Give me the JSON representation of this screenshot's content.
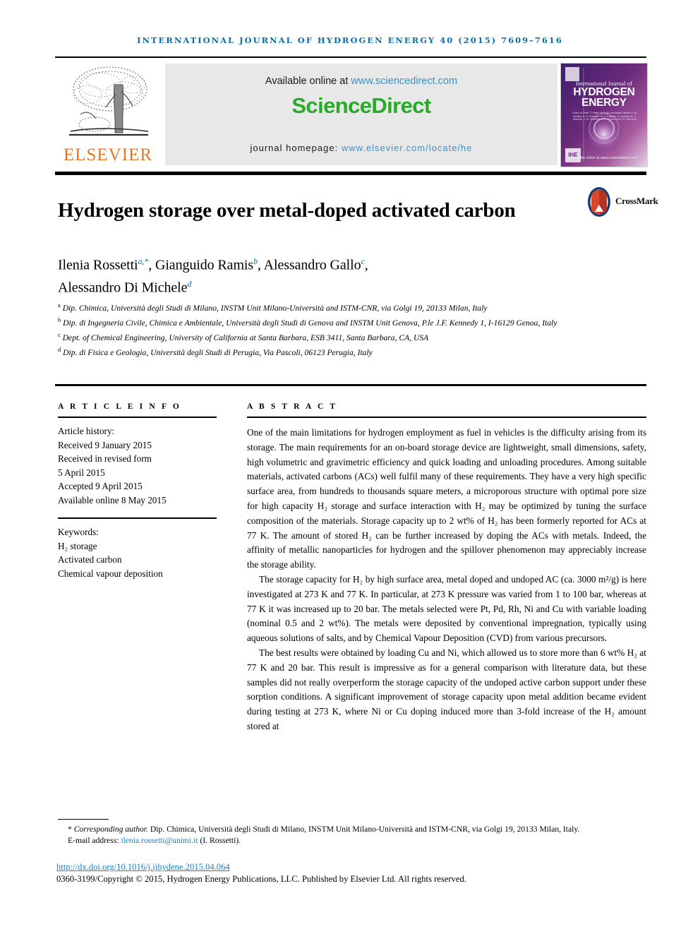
{
  "running_head": "International Journal of Hydrogen Energy 40 (2015) 7609–7616",
  "masthead": {
    "publisher_name": "ELSEVIER",
    "publisher_logo_alt": "elsevier-tree-logo",
    "available_prefix": "Available online at ",
    "available_url": "www.sciencedirect.com",
    "sciencedirect_wordmark": "ScienceDirect",
    "homepage_prefix": "journal homepage: ",
    "homepage_url": "www.elsevier.com/locate/he",
    "cover": {
      "line_small": "International Journal of",
      "line_big": "HYDROGEN ENERGY",
      "editors": "Editor-in-Chief:  T. Nejat Veziroğlu     Associate Editors:  A. M. Abdalla, D. G. Brandon, M. A. Kassem, A. Lavrova, A. C. Macedo, J. W. Sheffield, D. L. Cocke and D. A. Sverdrup",
      "sciencedirect_note": "Available online at www.sciencedirect.com"
    }
  },
  "article": {
    "title": "Hydrogen storage over metal-doped activated carbon",
    "crossmark_label": "CrossMark",
    "authors": [
      {
        "name": "Ilenia Rossetti",
        "marks": "a,*"
      },
      {
        "name": "Gianguido Ramis",
        "marks": "b"
      },
      {
        "name": "Alessandro Gallo",
        "marks": "c"
      },
      {
        "name": "Alessandro Di Michele",
        "marks": "d"
      }
    ],
    "affiliations": [
      {
        "mark": "a",
        "text": "Dip. Chimica, Università degli Studi di Milano, INSTM Unit Milano-Università and ISTM-CNR, via Golgi 19, 20133 Milan, Italy"
      },
      {
        "mark": "b",
        "text": "Dip. di Ingegneria Civile, Chimica e Ambientale, Università degli Studi di Genova and INSTM Unit Genova, P.le J.F. Kennedy 1, I-16129 Genoa, Italy"
      },
      {
        "mark": "c",
        "text": "Dept. of Chemical Engineering, University of California at Santa Barbara, ESB 3411, Santa Barbara, CA, USA"
      },
      {
        "mark": "d",
        "text": "Dip. di Fisica e Geologia, Università degli Studi di Perugia, Via Pascoli, 06123 Perugia, Italy"
      }
    ]
  },
  "article_info": {
    "heading": "A R T I C L E   I N F O",
    "history_heading": "Article history:",
    "history": [
      "Received 9 January 2015",
      "Received in revised form",
      "5 April 2015",
      "Accepted 9 April 2015",
      "Available online 8 May 2015"
    ],
    "keywords_heading": "Keywords:",
    "keywords": [
      "H₂ storage",
      "Activated carbon",
      "Chemical vapour deposition"
    ]
  },
  "abstract": {
    "heading": "A B S T R A C T",
    "paragraphs": [
      "One of the main limitations for hydrogen employment as fuel in vehicles is the difficulty arising from its storage. The main requirements for an on-board storage device are lightweight, small dimensions, safety, high volumetric and gravimetric efficiency and quick loading and unloading procedures. Among suitable materials, activated carbons (ACs) well fulfil many of these requirements. They have a very high specific surface area, from hundreds to thousands square meters, a microporous structure with optimal pore size for high capacity H₂ storage and surface interaction with H₂ may be optimized by tuning the surface composition of the materials. Storage capacity up to 2 wt% of H₂ has been formerly reported for ACs at 77 K. The amount of stored H₂ can be further increased by doping the ACs with metals. Indeed, the affinity of metallic nanoparticles for hydrogen and the spillover phenomenon may appreciably increase the storage ability.",
      "The storage capacity for H₂ by high surface area, metal doped and undoped AC (ca. 3000 m²/g) is here investigated at 273 K and 77 K. In particular, at 273 K pressure was varied from 1 to 100 bar, whereas at 77 K it was increased up to 20 bar. The metals selected were Pt, Pd, Rh, Ni and Cu with variable loading (nominal 0.5 and 2 wt%). The metals were deposited by conventional impregnation, typically using aqueous solutions of salts, and by Chemical Vapour Deposition (CVD) from various precursors.",
      "The best results were obtained by loading Cu and Ni, which allowed us to store more than 6 wt% H₂ at 77 K and 20 bar. This result is impressive as for a general comparison with literature data, but these samples did not really overperform the storage capacity of the undoped active carbon support under these sorption conditions. A significant improvement of storage capacity upon metal addition became evident during testing at 273 K, where Ni or Cu doping induced more than 3-fold increase of the H₂ amount stored at"
    ]
  },
  "footer": {
    "corresponding_star": "*",
    "corresponding_label": "Corresponding author.",
    "corresponding_address": " Dip. Chimica, Università degli Studi di Milano, INSTM Unit Milano-Università and ISTM-CNR, via Golgi 19, 20133 Milan, Italy.",
    "email_label": "E-mail address: ",
    "email": "ilenia.rossetti@unimi.it",
    "email_owner": " (I. Rossetti).",
    "doi": "http://dx.doi.org/10.1016/j.ijhydene.2015.04.064",
    "copyright": "0360-3199/Copyright © 2015, Hydrogen Energy Publications, LLC. Published by Elsevier Ltd. All rights reserved."
  },
  "colors": {
    "header_blue": "#0b6ea8",
    "link_blue": "#1a7fc1",
    "sciencedirect_green": "#2aaa2a",
    "elsevier_orange": "#e8761e",
    "cover_purple": "#5b2a6b"
  }
}
